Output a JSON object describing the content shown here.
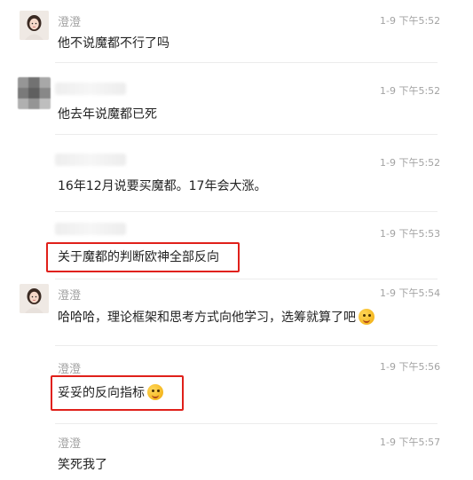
{
  "messages": [
    {
      "sender": "澄澄",
      "time": "1-9 下午5:52",
      "text": "他不说魔都不行了吗",
      "avatar": "girl-avatar"
    },
    {
      "sender": "",
      "time": "1-9 下午5:52",
      "text": "他去年说魔都已死",
      "avatar": "blurred-avatar"
    },
    {
      "sender": "",
      "time": "1-9 下午5:52",
      "text": "16年12月说要买魔都。17年会大涨。"
    },
    {
      "sender": "",
      "time": "1-9 下午5:53",
      "text": "关于魔都的判断欧神全部反向",
      "highlighted": true
    },
    {
      "sender": "澄澄",
      "time": "1-9 下午5:54",
      "text": "哈哈哈，理论框架和思考方式向他学习，选筹就算了吧",
      "avatar": "girl-avatar",
      "emoji": "smiling-emoji"
    },
    {
      "sender": "澄澄",
      "time": "1-9 下午5:56",
      "text": "妥妥的反向指标",
      "emoji": "smiling-emoji",
      "highlighted": true
    },
    {
      "sender": "澄澄",
      "time": "1-9 下午5:57",
      "text": "笑死我了"
    }
  ],
  "colors": {
    "highlight": "#e0201a",
    "meta": "#a3a3a3",
    "text": "#222222"
  }
}
